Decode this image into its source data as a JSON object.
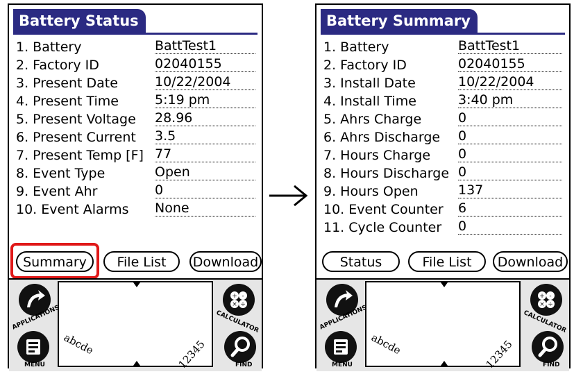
{
  "left_screen": {
    "title": "Battery Status",
    "rows": [
      {
        "label": "1. Battery",
        "value": "BattTest1"
      },
      {
        "label": "2. Factory ID",
        "value": "02040155"
      },
      {
        "label": "3. Present Date",
        "value": "10/22/2004"
      },
      {
        "label": "4. Present Time",
        "value": "5:19 pm"
      },
      {
        "label": "5. Present Voltage",
        "value": "28.96"
      },
      {
        "label": "6. Present Current",
        "value": "3.5"
      },
      {
        "label": "7. Present Temp [F]",
        "value": "77"
      },
      {
        "label": "8. Event Type",
        "value": "Open"
      },
      {
        "label": "9. Event Ahr",
        "value": "0"
      },
      {
        "label": "10. Event Alarms",
        "value": "None"
      }
    ],
    "buttons": {
      "b1": "Summary",
      "b2": "File List",
      "b3": "Download"
    }
  },
  "right_screen": {
    "title": "Battery Summary",
    "rows": [
      {
        "label": "1. Battery",
        "value": "BattTest1"
      },
      {
        "label": "2. Factory ID",
        "value": "02040155"
      },
      {
        "label": "3. Install Date",
        "value": "10/22/2004"
      },
      {
        "label": "4. Install Time",
        "value": "3:40 pm"
      },
      {
        "label": "5. Ahrs Charge",
        "value": "0"
      },
      {
        "label": "6. Ahrs Discharge",
        "value": "0"
      },
      {
        "label": "7. Hours Charge",
        "value": "0"
      },
      {
        "label": "8. Hours Discharge",
        "value": "0"
      },
      {
        "label": "9. Hours Open",
        "value": "137"
      },
      {
        "label": "10. Event Counter",
        "value": "6"
      },
      {
        "label": "11. Cycle Counter",
        "value": "0"
      }
    ],
    "buttons": {
      "b1": "Status",
      "b2": "File List",
      "b3": "Download"
    }
  },
  "graffiti": {
    "applications": "APPLICATIONS",
    "menu": "MENU",
    "calculator": "CALCULATOR",
    "find": "FIND",
    "abc": "abcde",
    "num": "12345"
  },
  "colors": {
    "title_bar": "#2b2a82",
    "highlight": "#e01818"
  },
  "icons": [
    "applications-icon",
    "menu-icon",
    "calculator-icon",
    "find-icon",
    "right-arrow-icon"
  ]
}
